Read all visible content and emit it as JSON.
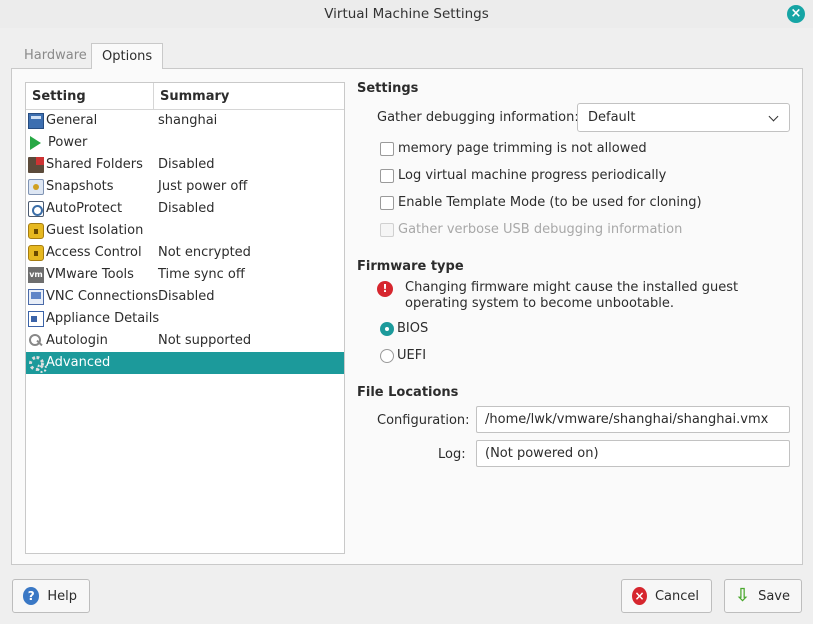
{
  "window": {
    "title": "Virtual Machine Settings",
    "close_glyph": "×"
  },
  "tabs": [
    {
      "label": "Hardware",
      "active": false
    },
    {
      "label": "Options",
      "active": true
    }
  ],
  "tree": {
    "headers": {
      "setting": "Setting",
      "summary": "Summary"
    },
    "rows": [
      {
        "name": "General",
        "summary": "shanghai",
        "icon": "general-icon"
      },
      {
        "name": "Power",
        "summary": "",
        "icon": "power-icon"
      },
      {
        "name": "Shared Folders",
        "summary": "Disabled",
        "icon": "folder-icon"
      },
      {
        "name": "Snapshots",
        "summary": "Just power off",
        "icon": "snapshot-icon"
      },
      {
        "name": "AutoProtect",
        "summary": "Disabled",
        "icon": "autoprotect-icon"
      },
      {
        "name": "Guest Isolation",
        "summary": "",
        "icon": "lock-icon"
      },
      {
        "name": "Access Control",
        "summary": "Not encrypted",
        "icon": "lock-icon"
      },
      {
        "name": "VMware Tools",
        "summary": "Time sync off",
        "icon": "vmware-icon"
      },
      {
        "name": "VNC Connections",
        "summary": "Disabled",
        "icon": "vnc-icon"
      },
      {
        "name": "Appliance Details",
        "summary": "",
        "icon": "appliance-icon"
      },
      {
        "name": "Autologin",
        "summary": "Not supported",
        "icon": "key-icon"
      },
      {
        "name": "Advanced",
        "summary": "",
        "icon": "gears-icon",
        "selected": true
      }
    ],
    "vm_icon_text": "vm"
  },
  "settings": {
    "title": "Settings",
    "debug_label": "Gather debugging information:",
    "debug_value": "Default",
    "checkboxes": [
      {
        "label": "memory page trimming is not allowed",
        "checked": false,
        "enabled": true
      },
      {
        "label": "Log virtual machine progress periodically",
        "checked": false,
        "enabled": true
      },
      {
        "label": "Enable Template Mode (to be used for cloning)",
        "checked": false,
        "enabled": true
      },
      {
        "label": "Gather verbose USB debugging information",
        "checked": false,
        "enabled": false
      }
    ]
  },
  "firmware": {
    "title": "Firmware type",
    "warning_glyph": "!",
    "warning": "Changing firmware might cause the installed guest operating system to become unbootable.",
    "options": [
      {
        "label": "BIOS",
        "selected": true
      },
      {
        "label": "UEFI",
        "selected": false
      }
    ]
  },
  "files": {
    "title": "File Locations",
    "config_label": "Configuration:",
    "config_value": "/home/lwk/vmware/shanghai/shanghai.vmx",
    "log_label": "Log:",
    "log_value": "(Not powered on)"
  },
  "buttons": {
    "help": "Help",
    "help_glyph": "?",
    "cancel": "Cancel",
    "cancel_glyph": "×",
    "save": "Save",
    "save_glyph": "⇩"
  },
  "colors": {
    "accent": "#1c9a9b",
    "warning": "#d6262e",
    "help": "#3a78c5"
  }
}
